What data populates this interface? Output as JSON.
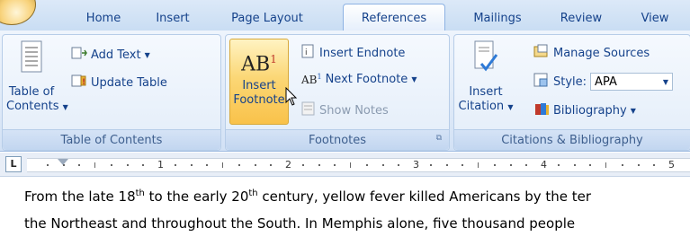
{
  "ribbon_tabs": [
    "Home",
    "Insert",
    "Page Layout",
    "References",
    "Mailings",
    "Review",
    "View"
  ],
  "active_tab": "References",
  "groups": {
    "toc": {
      "label": "Table of Contents",
      "toc_button": "Table of Contents",
      "toc_line1": "Table of",
      "toc_line2": "Contents",
      "add_text": "Add Text",
      "update_table": "Update Table"
    },
    "footnotes": {
      "label": "Footnotes",
      "insert_footnote_line1": "Insert",
      "insert_footnote_line2": "Footnote",
      "insert_footnote_icon_text": "AB",
      "insert_footnote_icon_sup": "1",
      "insert_endnote": "Insert Endnote",
      "next_footnote": "Next Footnote",
      "show_notes": "Show Notes"
    },
    "citations": {
      "label": "Citations & Bibliography",
      "insert_citation_line1": "Insert",
      "insert_citation_line2": "Citation",
      "manage_sources": "Manage Sources",
      "style_label": "Style:",
      "style_value": "APA",
      "bibliography": "Bibliography"
    }
  },
  "ruler": {
    "corner": "L",
    "numbers": [
      "1",
      "2",
      "3",
      "4",
      "5"
    ]
  },
  "document": {
    "line1": {
      "part1": "From the late 18",
      "sup1": "th",
      "part2": " to the early 20",
      "sup2": "th",
      "part3": " century, yellow fever killed Americans by the ter"
    },
    "line2": "the Northeast and throughout the South.  In Memphis alone, five thousand people"
  },
  "colors": {
    "ribbon_text": "#15428b",
    "group_label_text": "#3e5f8e",
    "hover_button": "#fbd776"
  },
  "icons": {
    "office_button": "office-logo-icon",
    "toc": "table-of-contents-icon",
    "add_text": "add-text-icon",
    "update_table": "update-table-icon",
    "insert_endnote": "insert-endnote-icon",
    "next_footnote": "next-footnote-icon",
    "show_notes": "show-notes-icon",
    "insert_citation": "insert-citation-icon",
    "manage_sources": "manage-sources-icon",
    "style": "style-icon",
    "bibliography": "bibliography-icon",
    "dialog_launcher": "dialog-launcher-icon",
    "cursor": "mouse-pointer-icon"
  }
}
